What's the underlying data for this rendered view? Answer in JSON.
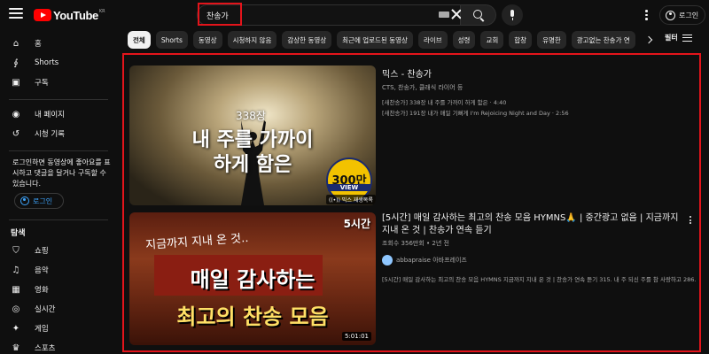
{
  "header": {
    "logo_text": "YouTube",
    "logo_country": "KR",
    "search_query": "찬송가",
    "login_label": "로그인"
  },
  "sidebar": {
    "items_main": [
      {
        "label": "홈",
        "icon": "home-icon"
      },
      {
        "label": "Shorts",
        "icon": "shorts-icon"
      },
      {
        "label": "구독",
        "icon": "subscriptions-icon"
      }
    ],
    "items_you": [
      {
        "label": "내 페이지",
        "icon": "account-icon"
      },
      {
        "label": "시청 기록",
        "icon": "history-icon"
      }
    ],
    "login_prompt": "로그인하면 동영상에 좋아요를 표시하고 댓글을 달거나 구독할 수 있습니다.",
    "login_label": "로그인",
    "explore_heading": "탐색",
    "items_explore": [
      {
        "label": "쇼핑",
        "icon": "shopping-icon"
      },
      {
        "label": "음악",
        "icon": "music-icon"
      },
      {
        "label": "영화",
        "icon": "movie-icon"
      },
      {
        "label": "실시간",
        "icon": "live-icon"
      },
      {
        "label": "게임",
        "icon": "gaming-icon"
      },
      {
        "label": "스포츠",
        "icon": "sports-icon"
      }
    ]
  },
  "chips": [
    "전체",
    "Shorts",
    "동영상",
    "시청하지 않음",
    "감상한 동영상",
    "최근에 업로드된 동영상",
    "라이브",
    "성령",
    "교회",
    "합창",
    "유명한",
    "광고없는 찬송가 연"
  ],
  "filter_label": "필터",
  "results": [
    {
      "title": "믹스 - 찬송가",
      "meta": "CTS, 찬송가, 클래식 라이어 등",
      "sub1": "[새찬송가] 338장 내 주를 가까이 하게 함은 · 4:40",
      "sub2": "[새찬송가] 191장 내가 매일 기뻐게 I'm Rejoicing Night and Day · 2:56",
      "thumb_number": "338장",
      "thumb_line1": "내 주를 가까이",
      "thumb_line2": "하게 함은",
      "badge_number": "300만",
      "badge_sub": "VIEW",
      "mix_tag": "((•)) 믹스 재생목록"
    },
    {
      "title": "[5시간] 매일 감사하는 최고의 찬송 모음 HYMNS🙏 | 중간광고 없음 | 지금까지 지내 온 것 | 찬송가 연속 듣기",
      "meta": "조회수 356만회 • 2년 전",
      "channel": "abbapraise 아바프레이즈",
      "sub1": "[5시간] 매일 감사하는 최고의 찬송 모음 HYMNS 지금까지 지내 온 것 | 찬송가 연속 듣기 315. 내 주 되신 주를 참 사랑하고 286.",
      "thumb_small": "지금까지 지내 온 것..",
      "thumb_big1": "매일 감사하는",
      "thumb_big2": "최고의 찬송 모음",
      "corner_tag": "5시간",
      "duration": "5:01:01"
    }
  ]
}
